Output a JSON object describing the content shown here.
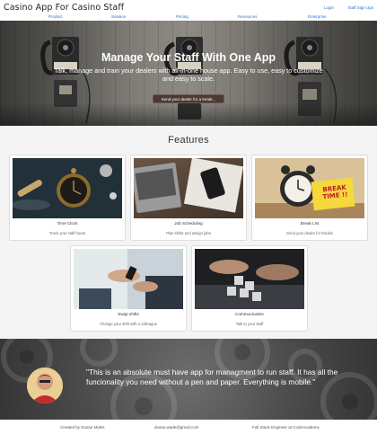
{
  "nav": {
    "brand": "Casino App For Casino Staff",
    "links": [
      "Product",
      "Solution",
      "Pricing",
      "Resources",
      "Enterprise"
    ],
    "login": "Login",
    "signup": "Staff Sign Ups"
  },
  "hero": {
    "title": "Manage Your Staff With One App",
    "subtitle": "Talk, manage and train your dealers with all-in-one house app. Easy to use, easy to customize and easy to scale.",
    "button": "Send your dealer for a break..."
  },
  "features": {
    "title": "Features",
    "cards": [
      {
        "title": "Time Clock",
        "desc": "Track your staff hours",
        "icon": "pocket-watch-icon"
      },
      {
        "title": "Job Scheduling",
        "desc": "Plan shifts and assign jobs",
        "icon": "laptop-phone-icon"
      },
      {
        "title": "Break List",
        "desc": "Send your dealer for breaks",
        "icon": "alarm-clock-icon"
      },
      {
        "title": "Swap shifts",
        "desc": "Change your shift with a colleague",
        "icon": "handshake-phone-icon"
      },
      {
        "title": "Communication",
        "desc": "Talk to your staff",
        "icon": "chat-hands-icon"
      }
    ],
    "break_note": "BREAK TIME !!"
  },
  "testimonial": {
    "quote": "\"This is an absolute must have app for managment to run staff. It has all the funcionality you need without a pen and paper. Everything is mobile.\""
  },
  "footer": {
    "created": "Created by Dusan Males",
    "email": "dusan.wade@gmail.com",
    "role": "Full Stack Engineer at CodeAcademy"
  },
  "colors": {
    "link": "#2b6fd6",
    "page_bg": "#f4f4f4",
    "hero_button": "#4a3a33"
  }
}
